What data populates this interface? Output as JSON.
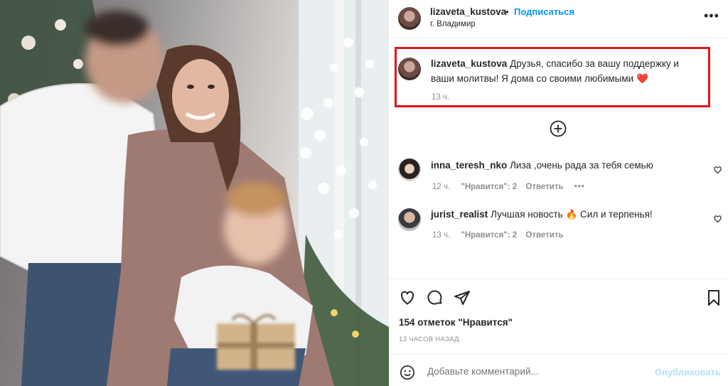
{
  "post": {
    "author": "lizaveta_kustova",
    "separator": "•",
    "follow_label": "Подписаться",
    "location": "г. Владимир",
    "more_label": "•••"
  },
  "caption": {
    "author": "lizaveta_kustova",
    "text": "Друзья, спасибо за вашу поддержку и ваши молитвы! Я дома со своими любимыми",
    "emoji": "❤️",
    "time": "13 ч."
  },
  "comments": [
    {
      "author": "inna_teresh_nko",
      "text": "Лиза ,очень рада за тебя семью",
      "time": "12 ч.",
      "likes": "\"Нравится\": 2",
      "reply": "Ответить",
      "more": "•••"
    },
    {
      "author": "jurist_realist",
      "text": "Лучшая новость 🔥 Сил и терпенья!",
      "time": "13 ч.",
      "likes": "\"Нравится\": 2",
      "reply": "Ответить"
    }
  ],
  "actions": {
    "like_icon": "heart-outline-icon",
    "comment_icon": "speech-bubble-icon",
    "share_icon": "paper-plane-icon",
    "save_icon": "bookmark-icon"
  },
  "likes_count": "154 отметок \"Нравится\"",
  "time_ago": "13 ЧАСОВ НАЗАД",
  "add_comment": {
    "placeholder": "Добавьте комментарий...",
    "publish_label": "Опубликовать"
  },
  "colors": {
    "accent": "#0095f6",
    "highlight_border": "#e0151f",
    "muted": "#8e8e8e",
    "publish_disabled": "#b2dffc"
  }
}
